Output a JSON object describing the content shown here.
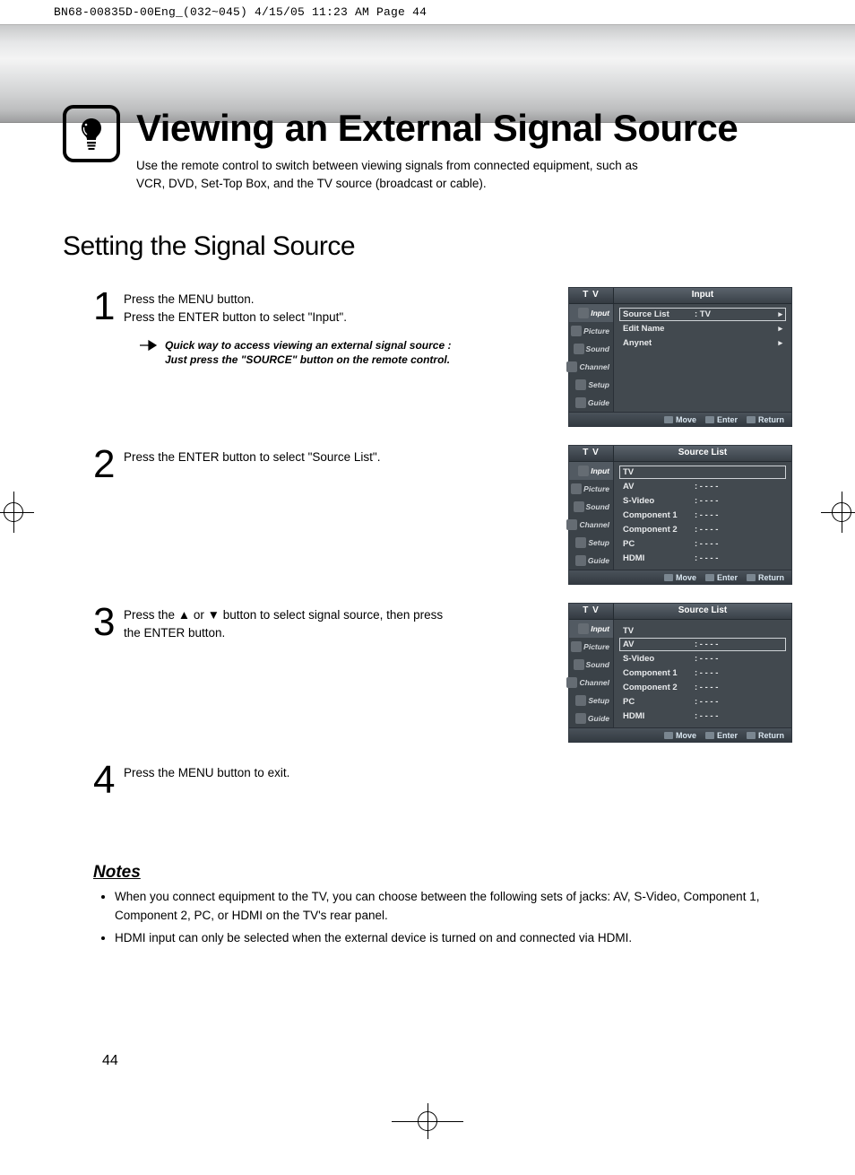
{
  "print_header": "BN68-00835D-00Eng_(032~045)  4/15/05  11:23 AM  Page 44",
  "title": "Viewing an External Signal Source",
  "subtitle": "Use the remote control to switch between viewing signals from connected equipment, such as VCR, DVD, Set-Top Box, and the TV source (broadcast or cable).",
  "section": "Setting the Signal Source",
  "steps": [
    {
      "num": "1",
      "text1": "Press the MENU button.",
      "text2": "Press the ENTER button to select \"Input\".",
      "tip1": "Quick way to access viewing an external signal source :",
      "tip2": "Just press the \"SOURCE\" button on the remote control."
    },
    {
      "num": "2",
      "text1": "Press the ENTER button to select \"Source List\"."
    },
    {
      "num": "3",
      "text1": "Press the ▲ or ▼ button to select signal source, then press the ENTER button."
    },
    {
      "num": "4",
      "text1": "Press the MENU button to exit."
    }
  ],
  "osd": {
    "top_left": "T V",
    "side_items": [
      "Input",
      "Picture",
      "Sound",
      "Channel",
      "Setup",
      "Guide"
    ],
    "panel1": {
      "title": "Input",
      "rows": [
        {
          "label": "Source List",
          "value": ": TV",
          "arrow": "▸",
          "hl": true
        },
        {
          "label": "Edit Name",
          "value": "",
          "arrow": "▸"
        },
        {
          "label": "Anynet",
          "value": "",
          "arrow": "▸"
        }
      ]
    },
    "panel2": {
      "title": "Source List",
      "rows": [
        {
          "label": "TV",
          "value": "",
          "hl": true
        },
        {
          "label": "AV",
          "value": ": - - - -"
        },
        {
          "label": "S-Video",
          "value": ": - - - -"
        },
        {
          "label": "Component 1",
          "value": ": - - - -"
        },
        {
          "label": "Component 2",
          "value": ": - - - -"
        },
        {
          "label": "PC",
          "value": ": - - - -"
        },
        {
          "label": "HDMI",
          "value": ": - - - -"
        }
      ]
    },
    "panel3": {
      "title": "Source List",
      "rows": [
        {
          "label": "TV",
          "value": ""
        },
        {
          "label": "AV",
          "value": ": - - - -",
          "hl": true
        },
        {
          "label": "S-Video",
          "value": ": - - - -"
        },
        {
          "label": "Component 1",
          "value": ": - - - -"
        },
        {
          "label": "Component 2",
          "value": ": - - - -"
        },
        {
          "label": "PC",
          "value": ": - - - -"
        },
        {
          "label": "HDMI",
          "value": ": - - - -"
        }
      ]
    },
    "foot": {
      "move": "Move",
      "enter": "Enter",
      "return": "Return"
    }
  },
  "notes_title": "Notes",
  "notes": [
    "When you connect equipment to the TV, you can choose between the following sets of jacks: AV, S-Video, Component 1, Component 2, PC, or HDMI on the TV's rear panel.",
    "HDMI input can only be selected when the external device is turned on and connected via HDMI."
  ],
  "page_number": "44"
}
